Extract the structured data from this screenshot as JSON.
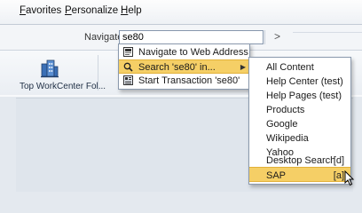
{
  "menubar": {
    "items": [
      {
        "accel": "F",
        "rest": "avorites"
      },
      {
        "accel": "P",
        "rest": "ersonalize"
      },
      {
        "accel": "H",
        "rest": "elp"
      }
    ]
  },
  "navigate": {
    "label": "Navigate:",
    "value": "se80",
    "go_label": ">"
  },
  "toolbar": {
    "workcenter_label": "Top WorkCenter Fol...",
    "workcenter_icon": "building-icon"
  },
  "popup": {
    "items": [
      {
        "label": "Navigate to Web Address",
        "icon": "web-address-icon"
      },
      {
        "label": "Search 'se80' in...",
        "icon": "search-icon",
        "selected": true,
        "has_submenu": true
      },
      {
        "label": "Start Transaction 'se80'",
        "icon": "transaction-icon"
      }
    ]
  },
  "submenu": {
    "items": [
      {
        "label": "All Content",
        "key": ""
      },
      {
        "label": "Help Center (test)",
        "key": ""
      },
      {
        "label": "Help Pages (test)",
        "key": ""
      },
      {
        "label": "Products",
        "key": ""
      },
      {
        "label": "Google",
        "key": ""
      },
      {
        "label": "Wikipedia",
        "key": ""
      },
      {
        "label": "Yahoo",
        "key": ""
      },
      {
        "label": "Desktop Search",
        "key": "[d]"
      },
      {
        "label": "SAP",
        "key": "[a]",
        "selected": true
      }
    ]
  },
  "colors": {
    "highlight": "#f5cf66",
    "highlight_border": "#e2b13a",
    "menu_border": "#8a99ad"
  }
}
